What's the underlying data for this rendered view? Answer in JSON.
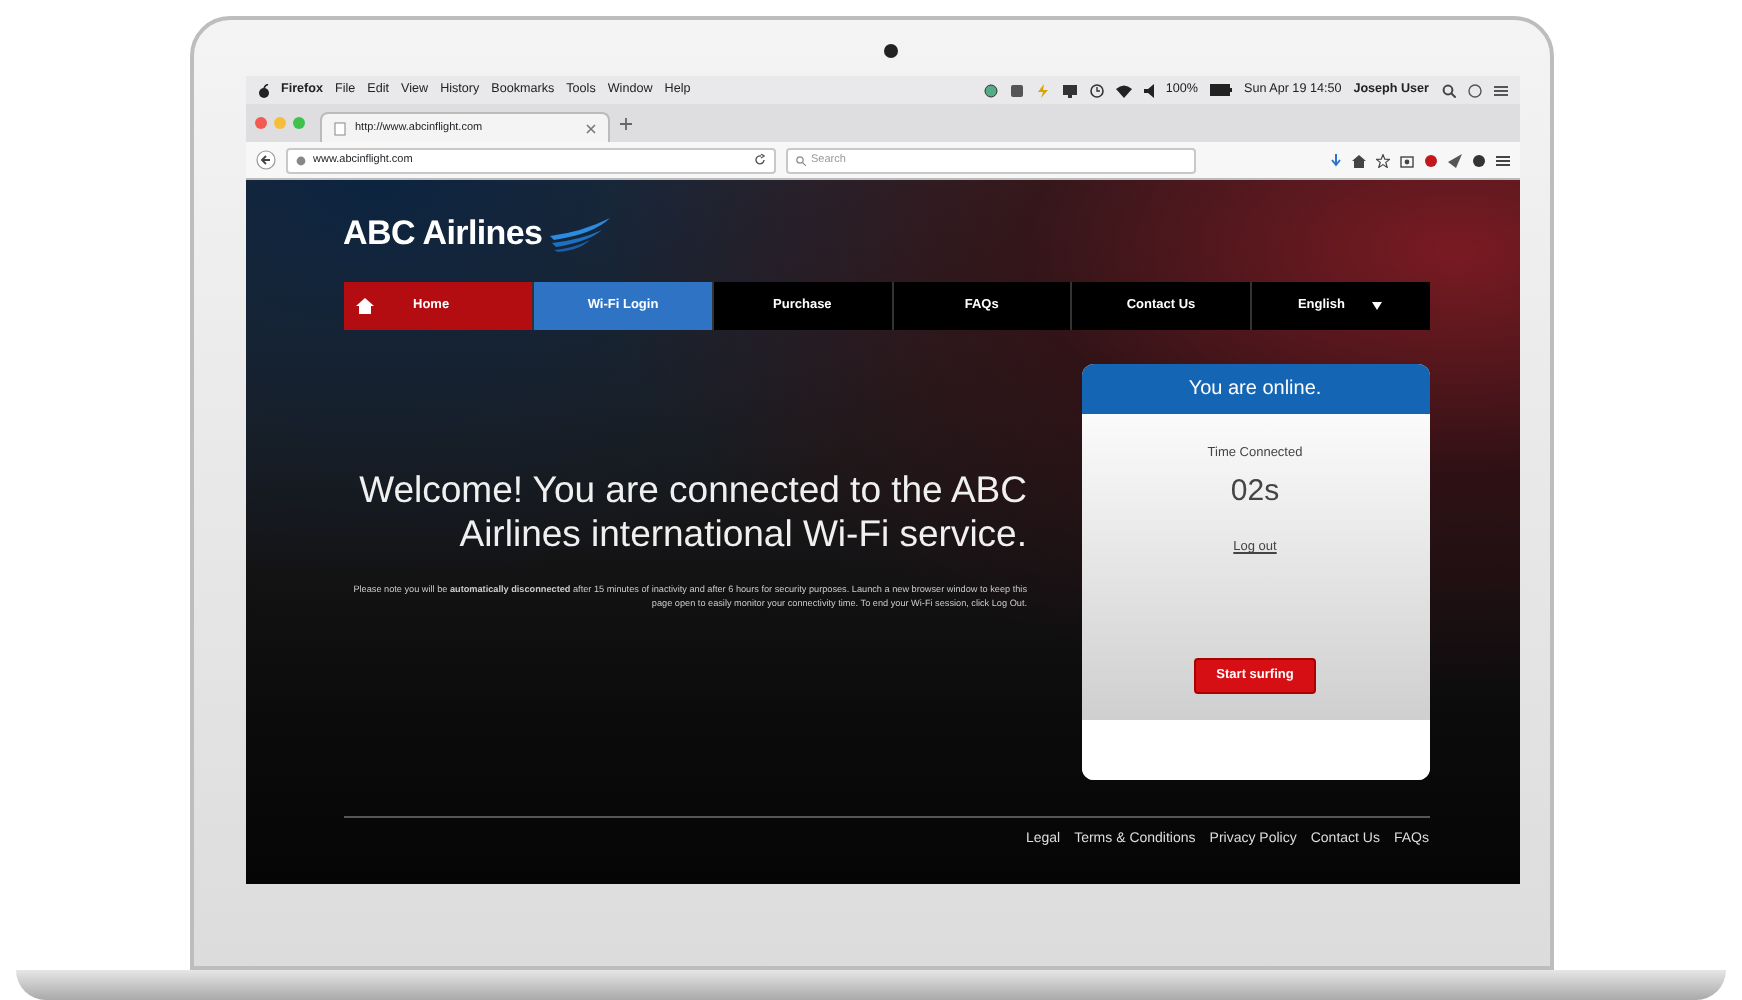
{
  "menu_bar": {
    "app_menus": [
      "Firefox",
      "File",
      "Edit",
      "View",
      "History",
      "Bookmarks",
      "Tools",
      "Window",
      "Help"
    ],
    "battery": "100%",
    "clock": "Sun Apr 19  14:50",
    "user": "Joseph User"
  },
  "browser": {
    "tab_title": "http://www.abcinflight.com",
    "url": "www.abcinflight.com",
    "search_placeholder": "Search"
  },
  "site": {
    "logo": "ABC Airlines",
    "nav": [
      {
        "kind": "home",
        "label": "Home",
        "selected": false
      },
      {
        "kind": "link",
        "label": "Wi-Fi Login",
        "selected": true
      },
      {
        "kind": "link",
        "label": "Purchase",
        "selected": false
      },
      {
        "kind": "link",
        "label": "FAQs",
        "selected": false
      },
      {
        "kind": "link",
        "label": "Contact Us",
        "selected": false
      },
      {
        "kind": "dropdown",
        "label": "English",
        "selected": false
      }
    ],
    "welcome": "Welcome! You are connected to the ABC Airlines international Wi-Fi service.",
    "note": "Please note you will be **automatically disconnected** after 15 minutes of inactivity and after 6 hours for security purposes. Launch a new browser window to keep this page open to easily monitor your connectivity time. To end your Wi-Fi session, click Log Out.",
    "status_card": {
      "header": "You are online.",
      "label": "Time Connected",
      "time": "02s",
      "logout": "Log out",
      "button": "Start surfing"
    },
    "footer_links": [
      "Legal",
      "Terms & Conditions",
      "Privacy Policy",
      "Contact Us",
      "FAQs"
    ]
  }
}
